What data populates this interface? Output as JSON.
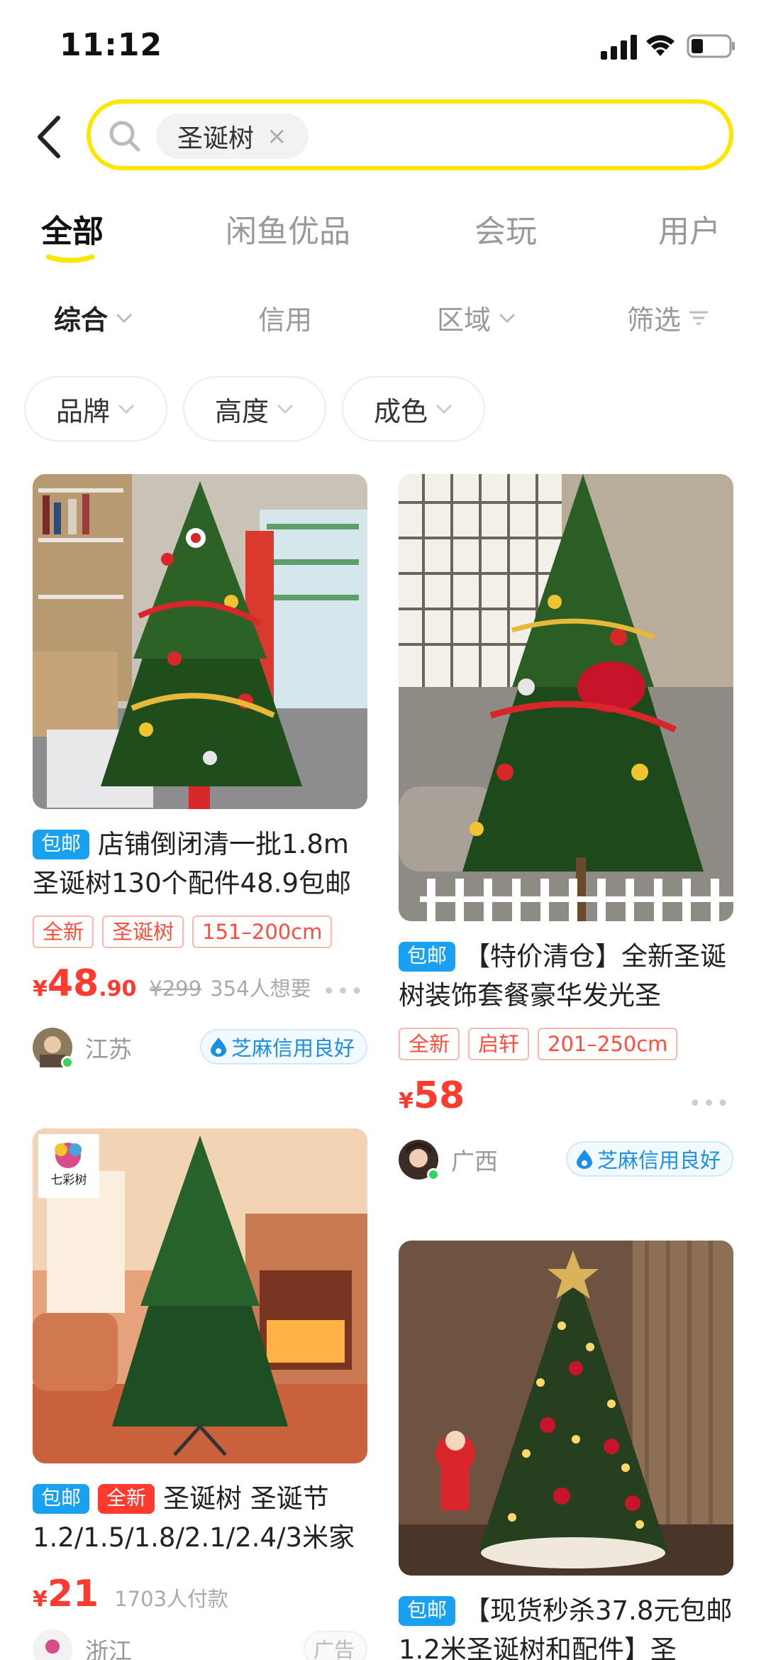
{
  "status_bar": {
    "time": "11:12"
  },
  "search": {
    "query": "圣诞树",
    "clear": "×"
  },
  "tabs": [
    {
      "label": "全部",
      "active": true
    },
    {
      "label": "闲鱼优品",
      "active": false
    },
    {
      "label": "会玩",
      "active": false
    },
    {
      "label": "用户",
      "active": false
    }
  ],
  "filters": [
    {
      "label": "综合",
      "active": true
    },
    {
      "label": "信用",
      "active": false
    },
    {
      "label": "区域",
      "active": false
    },
    {
      "label": "筛选",
      "active": false
    }
  ],
  "chips": [
    "品牌",
    "高度",
    "成色"
  ],
  "colors": {
    "accent": "#ffe600",
    "price": "#ff3a2f",
    "badge_blue": "#1aa0f0",
    "credit": "#1a8fe3"
  },
  "listings": [
    {
      "badges": [
        "包邮"
      ],
      "title": "店铺倒闭清一批1.8m圣诞树130个配件48.9包邮",
      "tags": [
        "全新",
        "圣诞树",
        "151–200cm"
      ],
      "yen": "¥",
      "price_int": "48",
      "price_dec": ".90",
      "original_price": "¥299",
      "wants": "354人想要",
      "more": "•••",
      "region": "江苏",
      "credit": "芝麻信用良好"
    },
    {
      "badges": [
        "包邮"
      ],
      "title": "【特价清仓】全新圣诞树装饰套餐豪华发光圣",
      "tags": [
        "全新",
        "启轩",
        "201–250cm"
      ],
      "yen": "¥",
      "price_int": "58",
      "more": "•••",
      "region": "广西",
      "credit": "芝麻信用良好"
    },
    {
      "badges": [
        "包邮",
        "全新"
      ],
      "title": "圣诞树 圣诞节1.2/1.5/1.8/2.1/2.4/3米家",
      "logo_text": "七彩树",
      "yen": "¥",
      "price_int": "21",
      "wants": "1703人付款",
      "region": "浙江",
      "ad": "广告"
    },
    {
      "badges": [
        "包邮"
      ],
      "title": "【现货秒杀37.8元包邮1.2米圣诞树和配件】圣"
    }
  ]
}
